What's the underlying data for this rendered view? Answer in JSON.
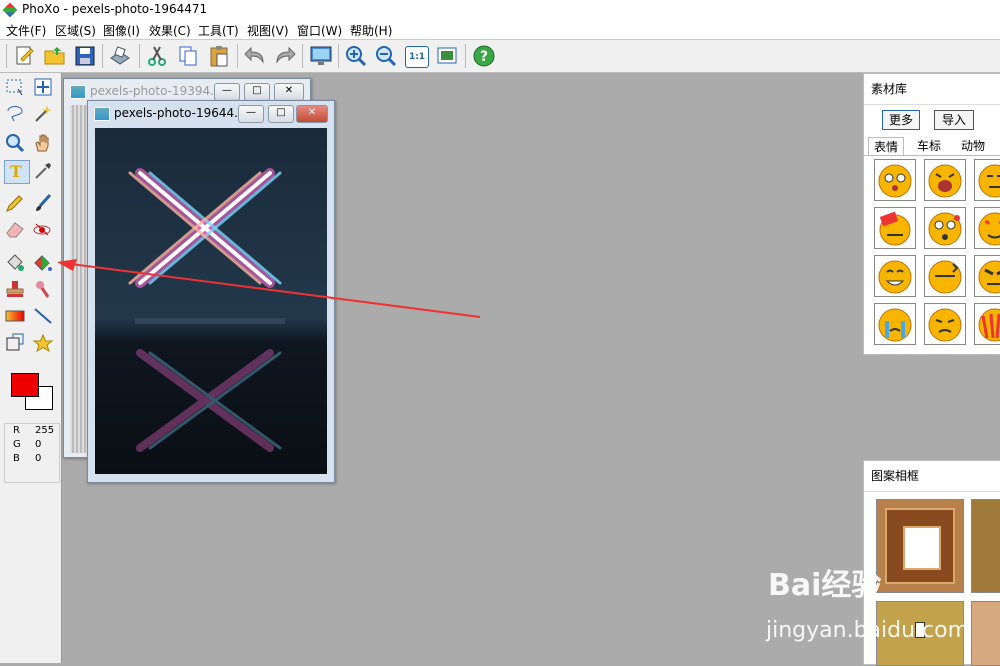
{
  "window": {
    "title": "PhoXo - pexels-photo-1964471"
  },
  "menu": [
    "文件(F)",
    "区域(S)",
    "图像(I)",
    "效果(C)",
    "工具(T)",
    "视图(V)",
    "窗口(W)",
    "帮助(H)"
  ],
  "toolbar_icons": [
    "new-icon",
    "open-icon",
    "save-icon",
    "scan-icon",
    "cut-icon",
    "copy-icon",
    "paste-icon",
    "undo-icon",
    "redo-icon",
    "screen-icon",
    "zoom-in-icon",
    "zoom-out-icon",
    "actual-size-icon",
    "fit-window-icon",
    "help-icon"
  ],
  "toolbar": {
    "actual_size_label": "1:1"
  },
  "tools": [
    "rect-select-icon",
    "move-icon",
    "lasso-icon",
    "magic-wand-icon",
    "zoom-icon",
    "hand-icon",
    "text-icon",
    "eyedropper-icon",
    "pencil-icon",
    "brush-icon",
    "eraser-icon",
    "red-eye-icon",
    "bucket-icon",
    "color-replace-icon",
    "stamp-icon",
    "smudge-icon",
    "gradient-icon",
    "line-icon",
    "transform-icon",
    "star-icon"
  ],
  "colors": {
    "foreground": "#ee0000",
    "background": "#ffffff"
  },
  "rgb": {
    "r_label": "R",
    "r": "255",
    "g_label": "G",
    "g": "0",
    "b_label": "B",
    "b": "0"
  },
  "documents": {
    "back": {
      "title": "pexels-photo-19394..."
    },
    "front": {
      "title": "pexels-photo-19644..."
    }
  },
  "material_panel": {
    "title": "素材库",
    "more_button": "更多",
    "import_button": "导入",
    "tabs": [
      "表情",
      "车标",
      "动物"
    ]
  },
  "frame_panel": {
    "title": "图案相框"
  },
  "watermark": {
    "text": "Bai经验",
    "url": "jingyan.baidu.com"
  }
}
